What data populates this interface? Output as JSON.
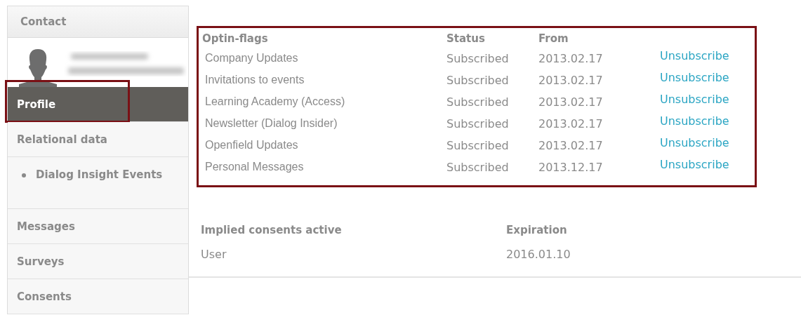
{
  "sidebar": {
    "header": "Contact",
    "items": [
      {
        "label": "Profile",
        "selected": true,
        "highlighted": true
      },
      {
        "label": "Relational data",
        "selected": false,
        "highlighted": false,
        "children": [
          {
            "label": "Dialog Insight Events",
            "selected": false
          }
        ]
      },
      {
        "label": "Messages",
        "selected": false,
        "highlighted": false
      },
      {
        "label": "Surveys",
        "selected": false,
        "highlighted": false
      },
      {
        "label": "Consents",
        "selected": false,
        "highlighted": false
      }
    ]
  },
  "optin_table": {
    "highlighted": true,
    "columns": [
      "Optin-flags",
      "Status",
      "From"
    ],
    "rows": [
      {
        "name": "Company Updates",
        "status": "Subscribed",
        "from": "2013.02.17",
        "action": "Unsubscribe"
      },
      {
        "name": "Invitations to events",
        "status": "Subscribed",
        "from": "2013.02.17",
        "action": "Unsubscribe"
      },
      {
        "name": "Learning Academy (Access)",
        "status": "Subscribed",
        "from": "2013.02.17",
        "action": "Unsubscribe"
      },
      {
        "name": "Newsletter (Dialog Insider)",
        "status": "Subscribed",
        "from": "2013.02.17",
        "action": "Unsubscribe"
      },
      {
        "name": "Openfield Updates",
        "status": "Subscribed",
        "from": "2013.02.17",
        "action": "Unsubscribe"
      },
      {
        "name": "Personal Messages",
        "status": "Subscribed",
        "from": "2013.12.17",
        "action": "Unsubscribe"
      }
    ]
  },
  "consents_table": {
    "columns": [
      "Implied consents active",
      "Expiration"
    ],
    "rows": [
      {
        "name": "User",
        "expiration": "2016.01.10"
      }
    ]
  }
}
